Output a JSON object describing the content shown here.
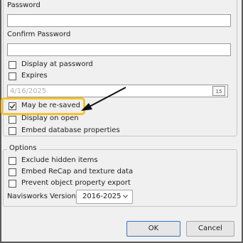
{
  "security": {
    "password_label": "Password",
    "password_value": "",
    "confirm_label": "Confirm Password",
    "confirm_value": "",
    "display_at_password_label": "Display at password",
    "display_at_password_checked": false,
    "expires_label": "Expires",
    "expires_checked": false,
    "expiry_date": "4/16/2025",
    "calendar_icon_text": "15",
    "may_be_resaved_label": "May be re-saved",
    "may_be_resaved_checked": true,
    "display_on_open_label": "Display on open",
    "display_on_open_checked": false,
    "embed_db_label": "Embed database properties",
    "embed_db_checked": false
  },
  "options": {
    "legend": "Options",
    "exclude_hidden_label": "Exclude hidden items",
    "exclude_hidden_checked": false,
    "embed_recap_label": "Embed ReCap and texture data",
    "embed_recap_checked": false,
    "prevent_export_label": "Prevent object property export",
    "prevent_export_checked": false,
    "version_label": "Navisworks Version",
    "version_value": "2016-2025"
  },
  "buttons": {
    "ok_label": "OK",
    "cancel_label": "Cancel"
  },
  "colors": {
    "highlight": "#f5c22f",
    "ok_border": "#2b78c5"
  },
  "icons": {
    "check": "check-icon",
    "calendar": "calendar-icon",
    "chevron": "chevron-down-icon",
    "arrow": "arrow-annotation-icon"
  }
}
